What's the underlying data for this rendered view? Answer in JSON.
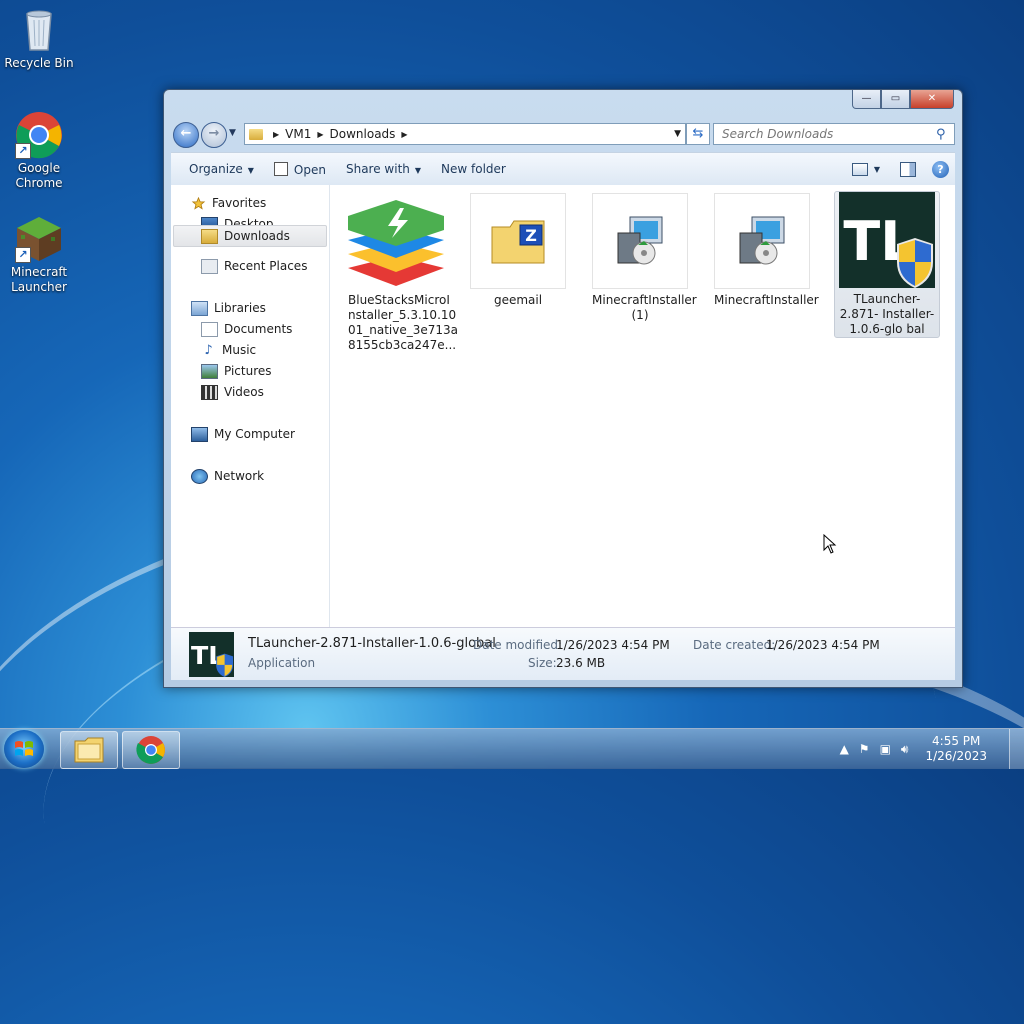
{
  "desktop": {
    "icons": [
      {
        "label": "Recycle Bin"
      },
      {
        "label": "Google Chrome"
      },
      {
        "label": "Minecraft Launcher"
      }
    ]
  },
  "window": {
    "caption_buttons": {
      "minimize": "—",
      "maximize": "▭",
      "close": "✕"
    },
    "address": {
      "root": "VM1",
      "folder": "Downloads"
    },
    "search_placeholder": "Search Downloads",
    "toolbar": {
      "organize": "Organize",
      "open": "Open",
      "share_with": "Share with",
      "new_folder": "New folder",
      "help": "?"
    },
    "nav": {
      "favorites": "Favorites",
      "desktop": "Desktop",
      "downloads": "Downloads",
      "recent_places": "Recent Places",
      "libraries": "Libraries",
      "documents": "Documents",
      "music": "Music",
      "pictures": "Pictures",
      "videos": "Videos",
      "my_computer": "My Computer",
      "network": "Network"
    },
    "files": [
      {
        "name": "BlueStacksMicroI nstaller_5.3.10.10 01_native_3e713a 8155cb3ca247e..."
      },
      {
        "name": "geemail"
      },
      {
        "name": "MinecraftInstaller (1)"
      },
      {
        "name": "MinecraftInstaller"
      },
      {
        "name": "TLauncher-2.871- Installer-1.0.6-glo bal"
      }
    ],
    "details": {
      "name": "TLauncher-2.871-Installer-1.0.6-global",
      "type": "Application",
      "modified_label": "Date modified:",
      "modified_value": "1/26/2023 4:54 PM",
      "created_label": "Date created:",
      "created_value": "1/26/2023 4:54 PM",
      "size_label": "Size:",
      "size_value": "23.6 MB"
    }
  },
  "taskbar": {
    "clock_time": "4:55 PM",
    "clock_date": "1/26/2023"
  },
  "icons": {
    "tlauncher_logo": "TL",
    "geemail_badge": "Z"
  }
}
